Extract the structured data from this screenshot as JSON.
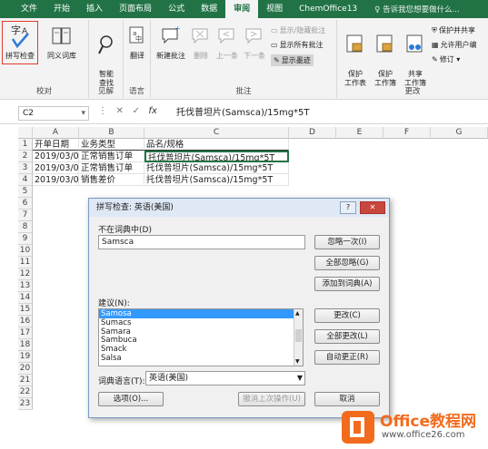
{
  "ribbon_tabs": [
    "文件",
    "开始",
    "插入",
    "页面布局",
    "公式",
    "数据",
    "审阅",
    "视图",
    "ChemOffice13"
  ],
  "active_tab": "审阅",
  "tell_me": "告诉我您想要做什么...",
  "groups": {
    "proofing": {
      "label": "校对",
      "spell": "拼写检查",
      "thesaurus": "同义词库"
    },
    "insights": {
      "label": "见解",
      "smart": "智能\n查找"
    },
    "language": {
      "label": "语言",
      "translate": "翻译"
    },
    "comments": {
      "label": "批注",
      "new": "新建批注",
      "delete": "删除",
      "prev": "上一条",
      "next": "下一条",
      "show_hide": "显示/隐藏批注",
      "show_all": "显示所有批注",
      "show_ink": "显示墨迹"
    },
    "changes": {
      "label": "更改",
      "protect_sheet": "保护\n工作表",
      "protect_book": "保护\n工作簿",
      "share_book": "共享\n工作簿",
      "protect_share": "保护并共享",
      "allow_edit": "允许用户编",
      "track": "修订 ▾"
    }
  },
  "namebox": "C2",
  "formula": "托伐普坦片(Samsca)/15mg*5T",
  "columns": [
    "A",
    "B",
    "C",
    "D",
    "E",
    "F",
    "G"
  ],
  "rows": [
    "1",
    "2",
    "3",
    "4",
    "5",
    "6",
    "7",
    "8",
    "9",
    "10",
    "11",
    "12",
    "13",
    "14",
    "15",
    "16",
    "17",
    "18",
    "19",
    "20",
    "21",
    "22",
    "23"
  ],
  "cells": [
    [
      "开单日期",
      "业务类型",
      "品名/规格"
    ],
    [
      "2019/03/0",
      "正常销售订单",
      "托伐普坦片(Samsca)/15mg*5T"
    ],
    [
      "2019/03/0",
      "正常销售订单",
      "托伐普坦片(Samsca)/15mg*5T"
    ],
    [
      "2019/03/0",
      "销售差价",
      "托伐普坦片(Samsca)/15mg*5T"
    ]
  ],
  "dialog": {
    "title": "拼写检查: 英语(美国)",
    "help": "?",
    "close": "✕",
    "not_in_dict_label": "不在词典中(D)",
    "word": "Samsca",
    "suggest_label": "建议(N):",
    "suggestions": [
      "Samosa",
      "Sumacs",
      "Samara",
      "Sambuca",
      "Smack",
      "Salsa"
    ],
    "dict_lang_label": "词典语言(T):",
    "dict_lang": "英语(美国)",
    "buttons": {
      "ignore_once": "忽略一次(I)",
      "ignore_all": "全部忽略(G)",
      "add_dict": "添加到词典(A)",
      "change": "更改(C)",
      "change_all": "全部更改(L)",
      "autocorrect": "自动更正(R)",
      "options": "选项(O)...",
      "undo": "撤消上次操作(U)",
      "cancel": "取消"
    }
  },
  "watermark": {
    "title": "Office教程网",
    "url": "www.office26.com"
  },
  "colors": {
    "excel_green": "#217346",
    "selection_red": "#e23b2e",
    "watermark_orange": "#f26b1d"
  }
}
